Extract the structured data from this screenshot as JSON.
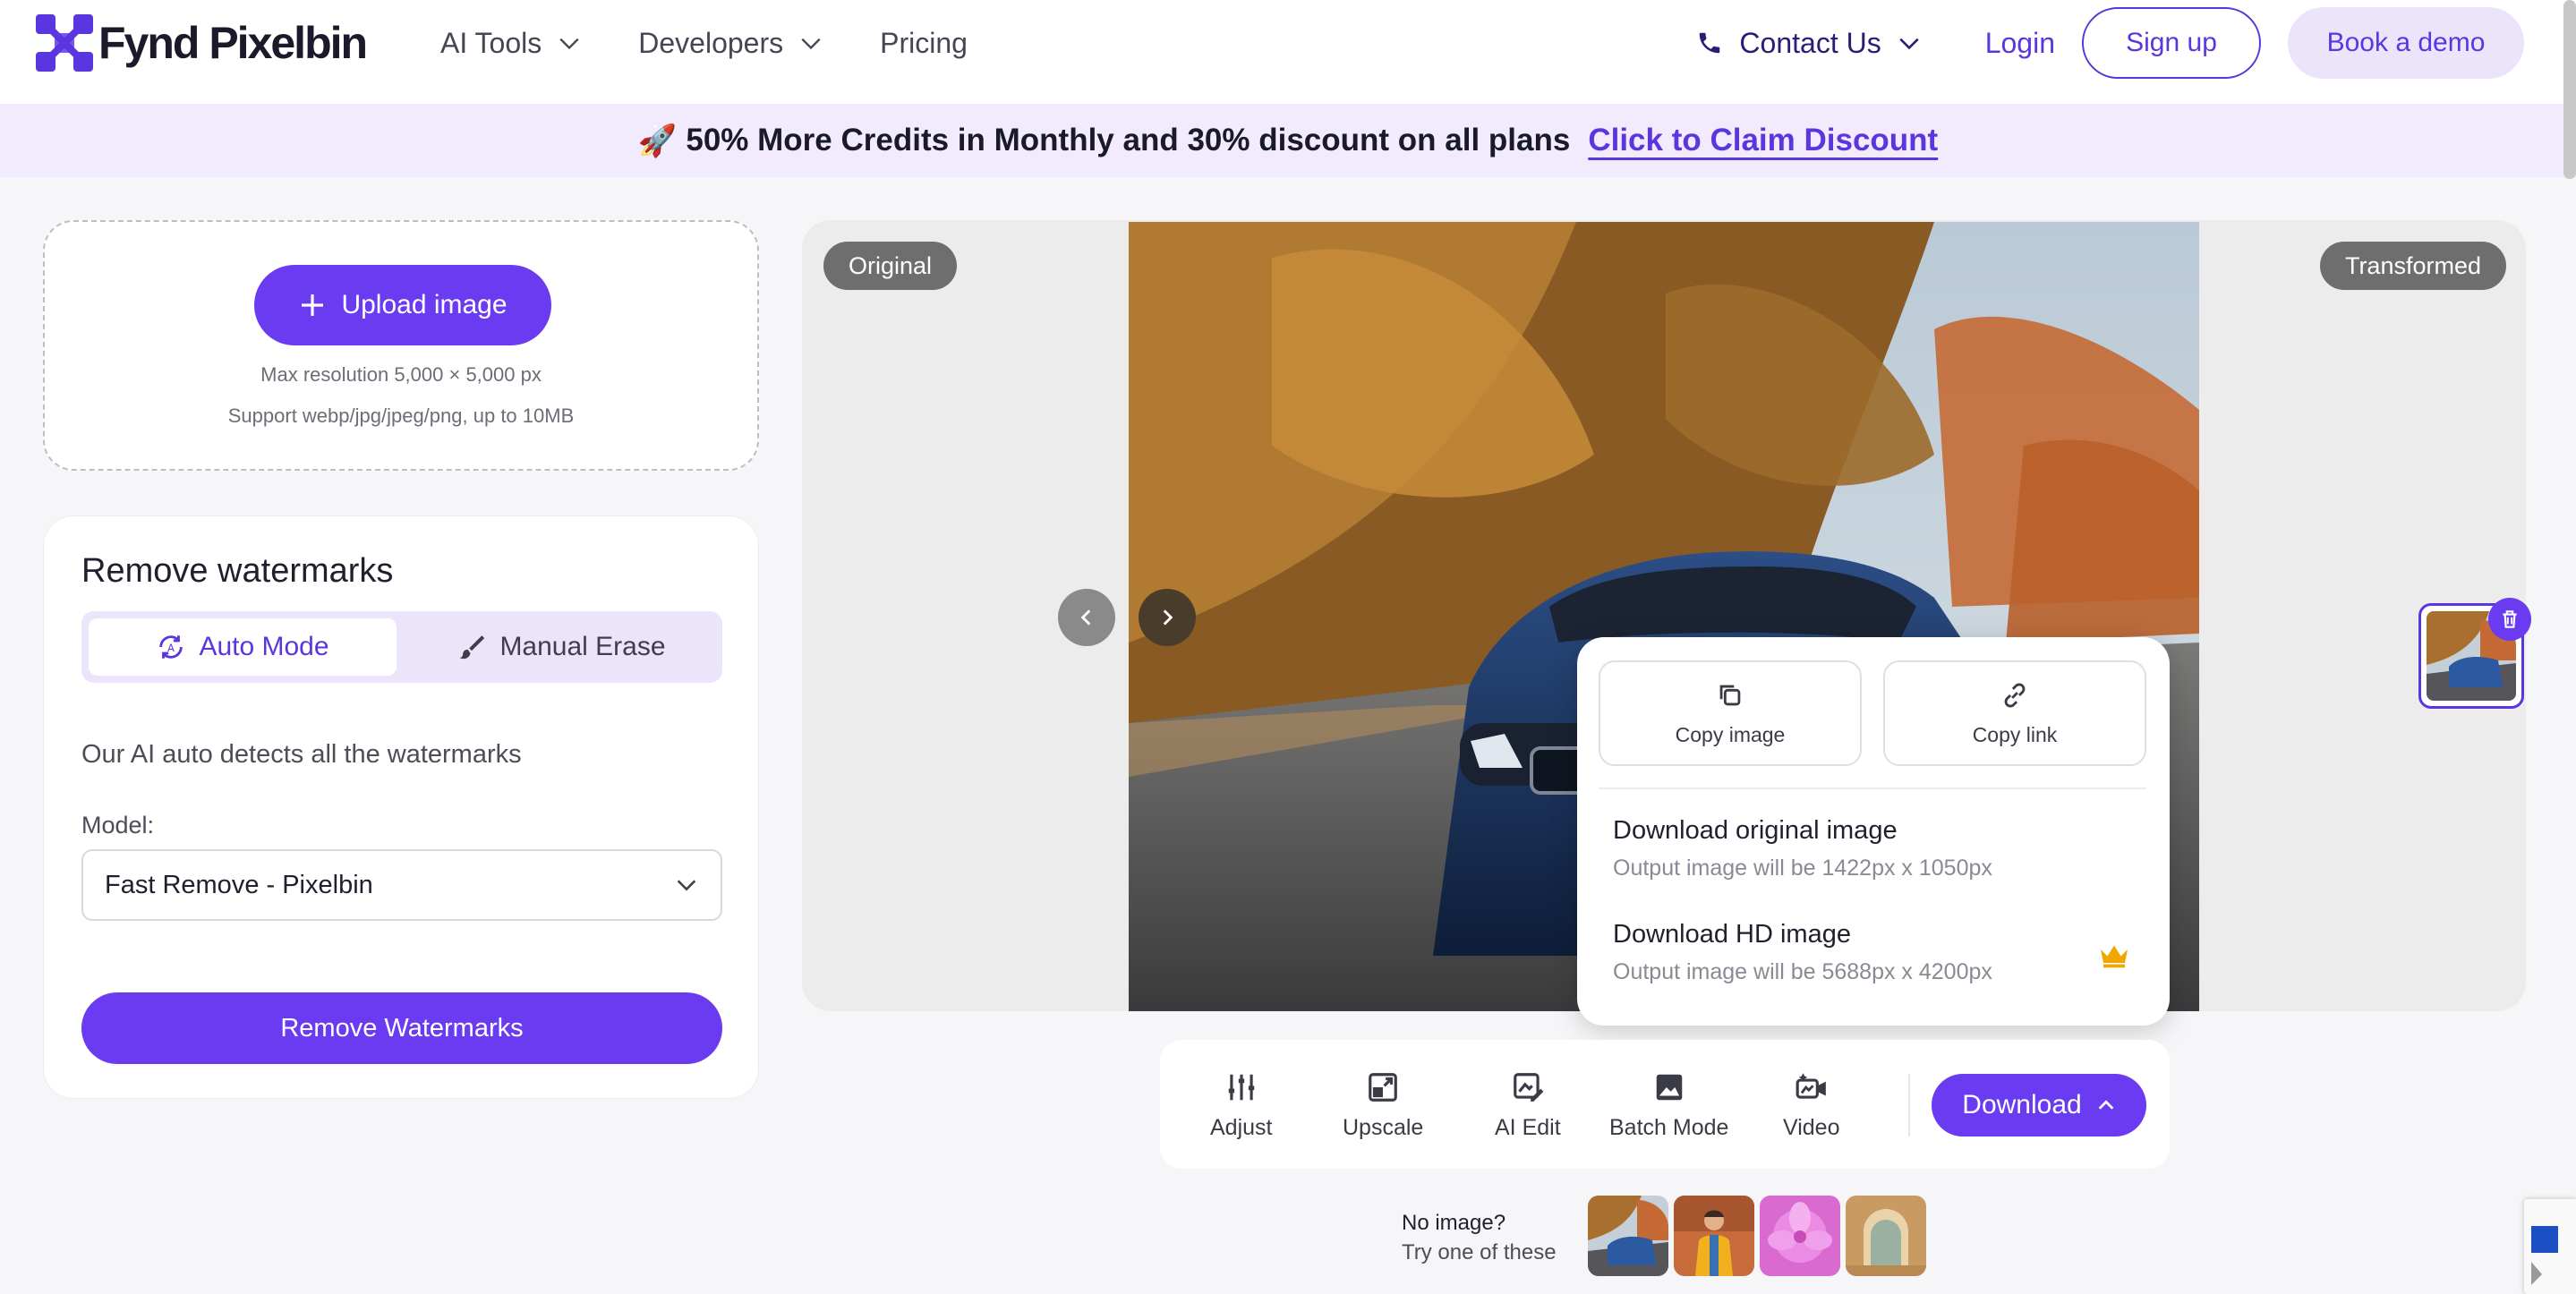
{
  "brand": {
    "name": "Fynd Pixelbin",
    "accent": "#6a3bf0",
    "accent_light": "#ebe4fb"
  },
  "nav": {
    "items": [
      {
        "label": "AI Tools",
        "dropdown": true
      },
      {
        "label": "Developers",
        "dropdown": true
      },
      {
        "label": "Pricing",
        "dropdown": false
      }
    ],
    "contact_label": "Contact Us",
    "login_label": "Login",
    "signup_label": "Sign up",
    "demo_label": "Book a demo"
  },
  "promo": {
    "emoji": "🚀",
    "text": "50% More Credits in Monthly and 30% discount on all plans",
    "link_label": "Click to Claim Discount"
  },
  "upload": {
    "button_label": "Upload image",
    "max_resolution": "Max resolution 5,000 × 5,000 px",
    "support": "Support webp/jpg/jpeg/png, up to 10MB"
  },
  "panel": {
    "title": "Remove watermarks",
    "modes": [
      {
        "label": "Auto Mode",
        "active": true
      },
      {
        "label": "Manual Erase",
        "active": false
      }
    ],
    "description": "Our AI auto detects all the watermarks",
    "model_label": "Model:",
    "model_value": "Fast Remove - Pixelbin",
    "action_label": "Remove Watermarks"
  },
  "preview": {
    "original_tag": "Original",
    "transformed_tag": "Transformed"
  },
  "download_menu": {
    "copy_image": "Copy image",
    "copy_link": "Copy link",
    "options": [
      {
        "title": "Download original image",
        "subtitle": "Output image will be 1422px x 1050px",
        "premium": false
      },
      {
        "title": "Download HD image",
        "subtitle": "Output image will be 5688px x 4200px",
        "premium": true
      }
    ]
  },
  "toolbar": {
    "tools": [
      {
        "label": "Adjust",
        "icon": "sliders-icon"
      },
      {
        "label": "Upscale",
        "icon": "upscale-icon"
      },
      {
        "label": "AI Edit",
        "icon": "ai-edit-icon"
      },
      {
        "label": "Batch Mode",
        "icon": "image-icon"
      },
      {
        "label": "Video",
        "icon": "video-icon"
      }
    ],
    "download_label": "Download"
  },
  "samples": {
    "line1": "No image?",
    "line2": "Try one of these"
  }
}
